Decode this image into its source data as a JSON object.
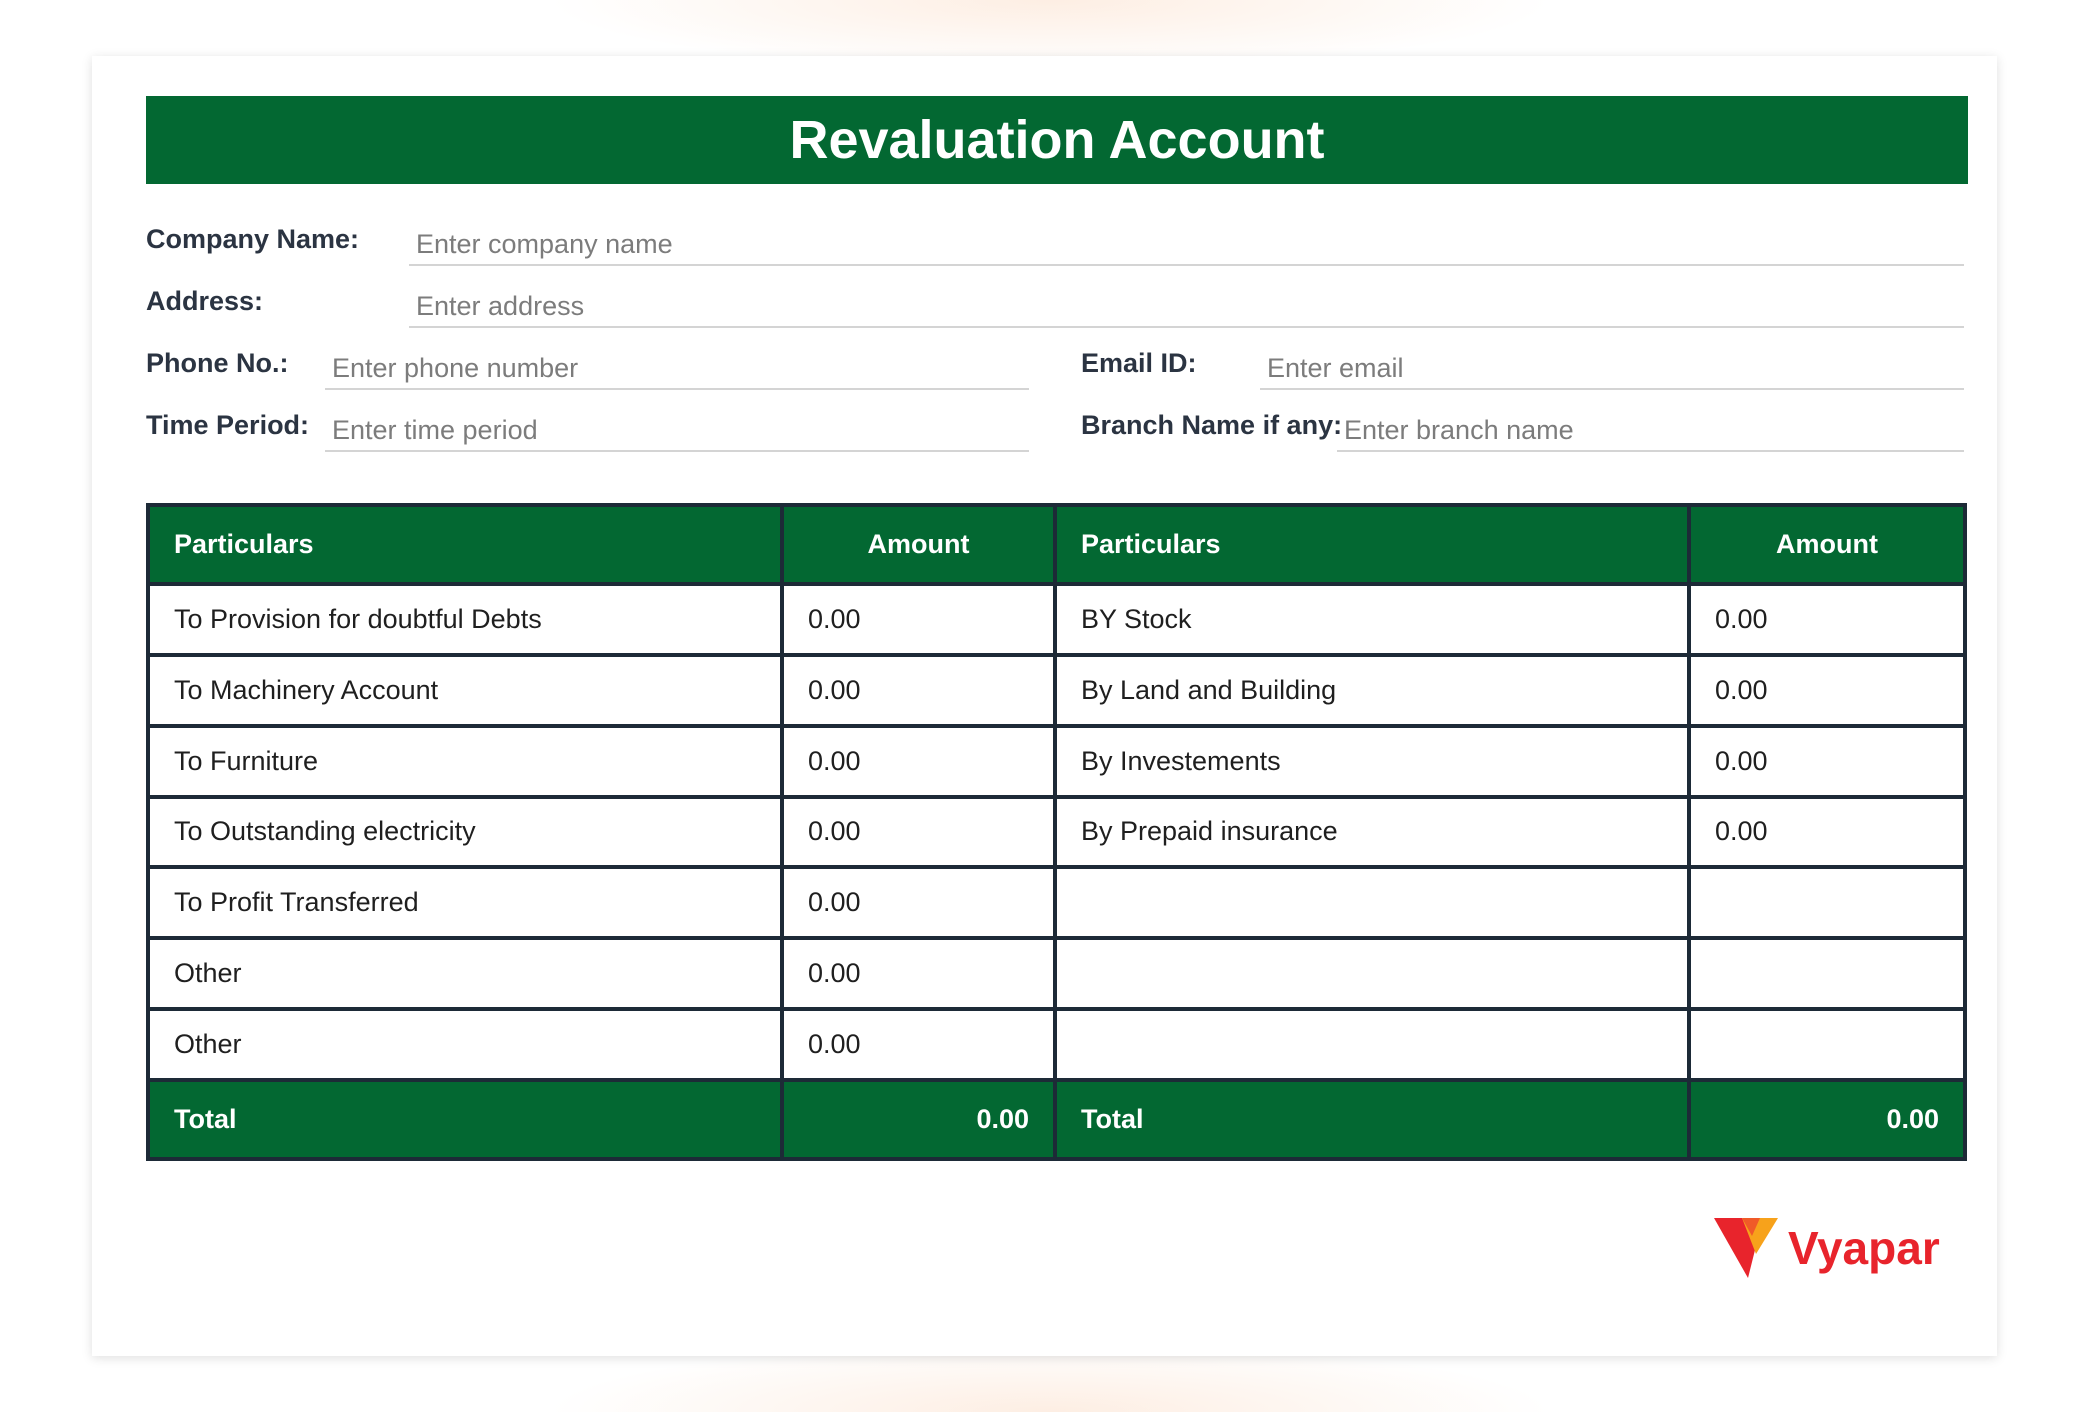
{
  "title": "Revaluation Account",
  "form": {
    "company_name": {
      "label": "Company Name:",
      "placeholder": "Enter company name"
    },
    "address": {
      "label": "Address:",
      "placeholder": "Enter address"
    },
    "phone": {
      "label": "Phone No.:",
      "placeholder": "Enter phone number"
    },
    "email": {
      "label": "Email ID:",
      "placeholder": "Enter email"
    },
    "time_period": {
      "label": "Time Period:",
      "placeholder": "Enter time period"
    },
    "branch": {
      "label": "Branch Name if any:",
      "placeholder": "Enter branch name"
    }
  },
  "table": {
    "headers": [
      "Particulars",
      "Amount",
      "Particulars",
      "Amount"
    ],
    "rows": [
      {
        "dr_particular": "To Provision for doubtful Debts",
        "dr_amount": "0.00",
        "cr_particular": "BY Stock",
        "cr_amount": "0.00"
      },
      {
        "dr_particular": "To Machinery Account",
        "dr_amount": "0.00",
        "cr_particular": "By Land and Building",
        "cr_amount": "0.00"
      },
      {
        "dr_particular": "To Furniture",
        "dr_amount": "0.00",
        "cr_particular": "By Investements",
        "cr_amount": "0.00"
      },
      {
        "dr_particular": "To Outstanding electricity",
        "dr_amount": "0.00",
        "cr_particular": "By Prepaid insurance",
        "cr_amount": "0.00"
      },
      {
        "dr_particular": "To Profit Transferred",
        "dr_amount": "0.00",
        "cr_particular": "",
        "cr_amount": ""
      },
      {
        "dr_particular": "Other",
        "dr_amount": "0.00",
        "cr_particular": "",
        "cr_amount": ""
      },
      {
        "dr_particular": "Other",
        "dr_amount": "0.00",
        "cr_particular": "",
        "cr_amount": ""
      }
    ],
    "totals": {
      "dr_label": "Total",
      "dr_amount": "0.00",
      "cr_label": "Total",
      "cr_amount": "0.00"
    }
  },
  "brand": {
    "name": "Vyapar",
    "primary_color": "#036832",
    "logo_color": "#e8242c"
  }
}
